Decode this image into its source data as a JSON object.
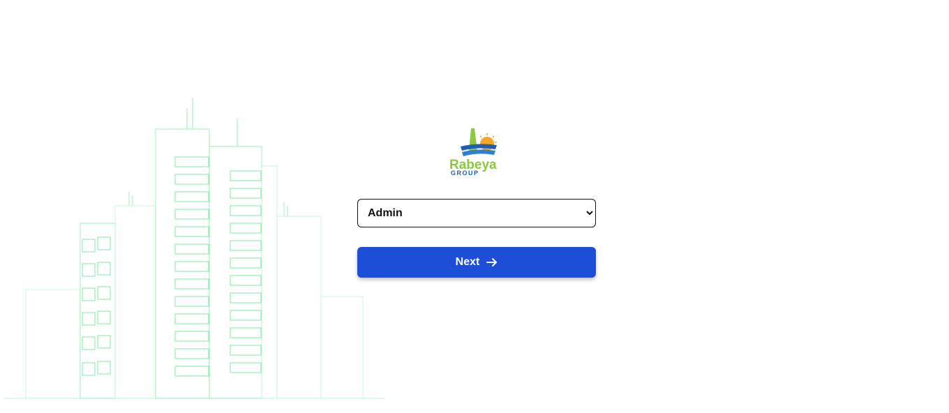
{
  "logo": {
    "line1": "Rabeya",
    "line2": "GROUP"
  },
  "role_select": {
    "selected": "Admin",
    "options": [
      "Admin"
    ]
  },
  "next_button": {
    "label": "Next",
    "icon": "arrow-right-icon"
  },
  "colors": {
    "button_bg": "#1d4ed8",
    "illustration_line": "#4ade80",
    "logo_green": "#8dc63f",
    "logo_blue": "#1e5fb4",
    "logo_sun": "#f5a623"
  }
}
